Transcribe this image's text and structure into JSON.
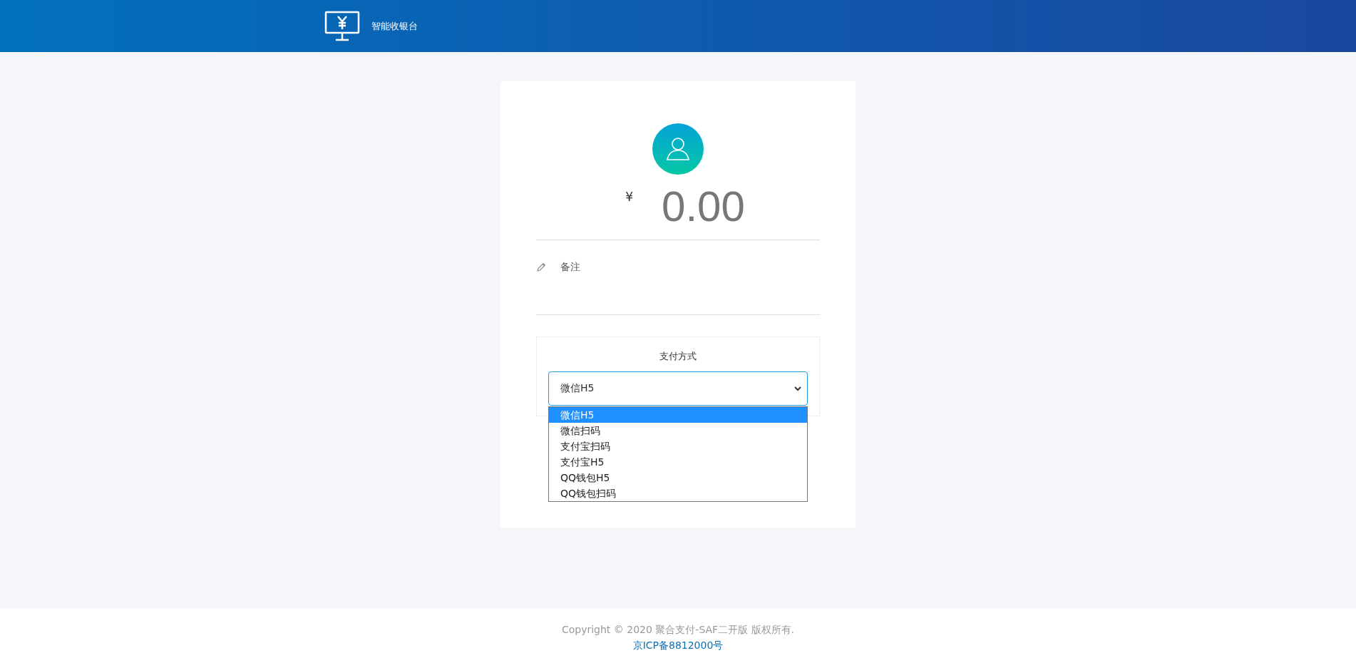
{
  "header": {
    "title": "智能收银台"
  },
  "amount": {
    "currency": "¥",
    "value": "0.00"
  },
  "remark": {
    "label": "备注"
  },
  "payment": {
    "label": "支付方式",
    "value": "微信H5",
    "options": [
      {
        "label": "微信H5",
        "selected": true
      },
      {
        "label": "微信扫码",
        "selected": false
      },
      {
        "label": "支付宝扫码",
        "selected": false
      },
      {
        "label": "支付宝H5",
        "selected": false
      },
      {
        "label": "QQ钱包H5",
        "selected": false
      },
      {
        "label": "QQ钱包扫码",
        "selected": false
      }
    ]
  },
  "footer": {
    "copyright": "Copyright © 2020 聚合支付-SAF二开版 版权所有.",
    "icp": "京ICP备8812000号"
  }
}
